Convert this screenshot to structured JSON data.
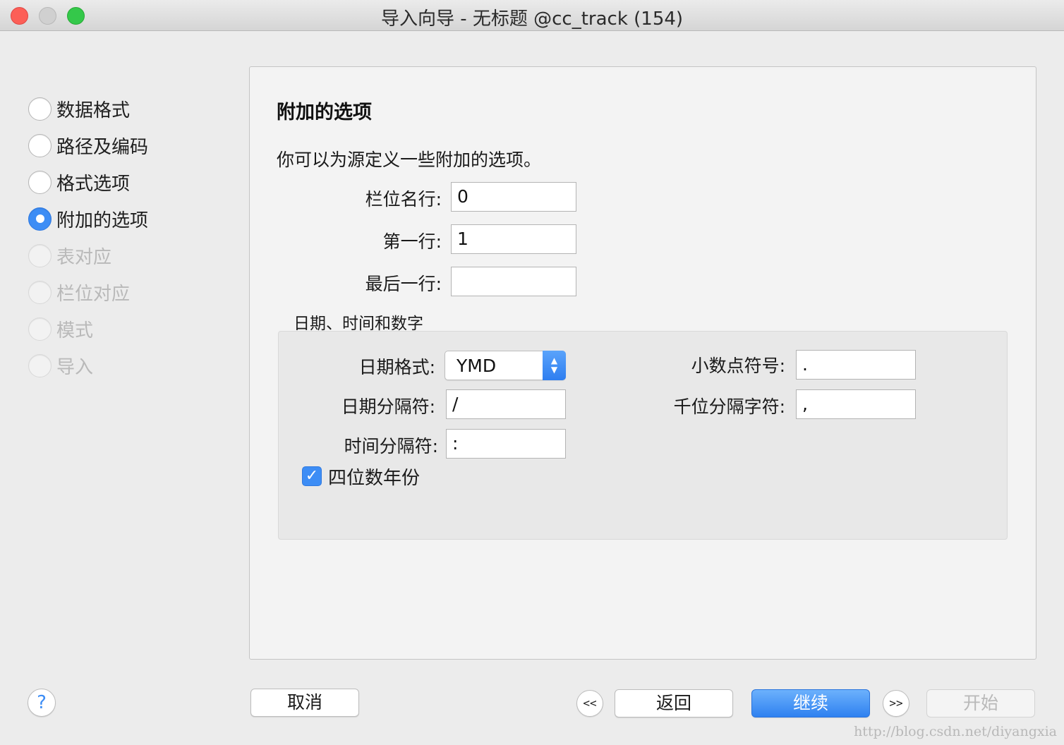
{
  "window": {
    "title": "导入向导 - 无标题 @cc_track (154)"
  },
  "steps": [
    {
      "label": "数据格式",
      "state": "enabled"
    },
    {
      "label": "路径及编码",
      "state": "enabled"
    },
    {
      "label": "格式选项",
      "state": "enabled"
    },
    {
      "label": "附加的选项",
      "state": "active"
    },
    {
      "label": "表对应",
      "state": "disabled"
    },
    {
      "label": "栏位对应",
      "state": "disabled"
    },
    {
      "label": "模式",
      "state": "disabled"
    },
    {
      "label": "导入",
      "state": "disabled"
    }
  ],
  "panel": {
    "title": "附加的选项",
    "description": "你可以为源定义一些附加的选项。",
    "field_name_row": {
      "label": "栏位名行:",
      "value": "0"
    },
    "first_row": {
      "label": "第一行:",
      "value": "1"
    },
    "last_row": {
      "label": "最后一行:",
      "value": ""
    },
    "group_title": "日期、时间和数字",
    "date_format": {
      "label": "日期格式:",
      "value": "YMD"
    },
    "date_separator": {
      "label": "日期分隔符:",
      "value": "/"
    },
    "time_separator": {
      "label": "时间分隔符:",
      "value": ":"
    },
    "decimal_symbol": {
      "label": "小数点符号:",
      "value": "."
    },
    "thousands_separator": {
      "label": "千位分隔字符:",
      "value": ","
    },
    "four_digit_year": {
      "label": "四位数年份",
      "checked": true
    }
  },
  "buttons": {
    "help": "?",
    "cancel": "取消",
    "first": "<<",
    "back": "返回",
    "continue": "继续",
    "last": ">>",
    "start": "开始"
  },
  "watermark": "http://blog.csdn.net/diyangxia",
  "colors": {
    "accent": "#3d8df5",
    "close": "#fc5f57",
    "maximize": "#34c84a"
  }
}
